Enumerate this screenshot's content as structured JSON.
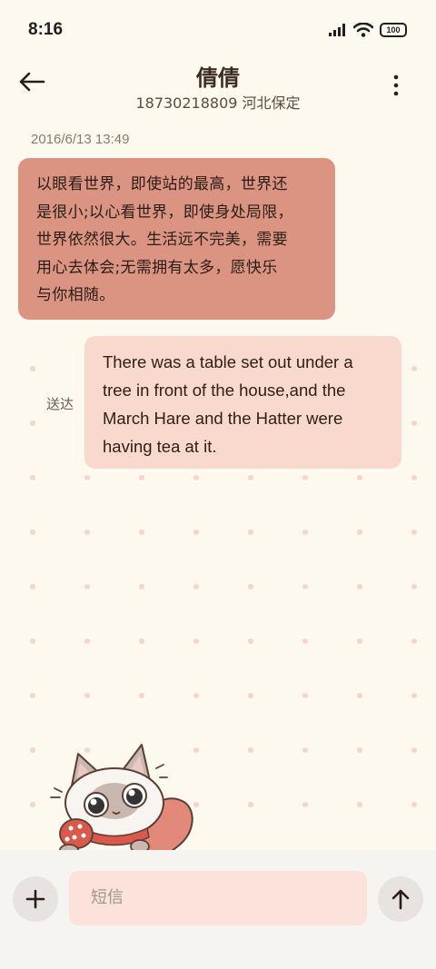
{
  "status": {
    "time": "8:16",
    "battery": "100",
    "signal_icon": "signal-bars-icon",
    "wifi_icon": "wifi-icon"
  },
  "header": {
    "contact_name": "倩倩",
    "phone_location": "18730218809 河北保定",
    "back_icon": "back-arrow-icon",
    "menu_icon": "more-vertical-icon"
  },
  "conversation": {
    "timestamp": "2016/6/13 13:49",
    "incoming_lines": [
      "以眼看世界，即使站的最高，世界还",
      "是很小;以心看世界，即使身处局限，",
      "世界依然很大。生活远不完美，需要",
      "用心去体会;无需拥有太多，愿快乐",
      "与你相随。"
    ],
    "outgoing_lines": [
      "There was a table set out under a",
      "tree in front of the house,and the",
      "March Hare and the Hatter were",
      "having tea at it."
    ],
    "delivered_label": "送达"
  },
  "composer": {
    "placeholder": "短信",
    "add_icon": "plus-icon",
    "send_icon": "send-arrow-up-icon"
  },
  "colors": {
    "background": "#fdf9ee",
    "incoming_bubble": "#db9482",
    "outgoing_bubble": "#f9d8cd",
    "input_background": "#fbe3dc"
  }
}
